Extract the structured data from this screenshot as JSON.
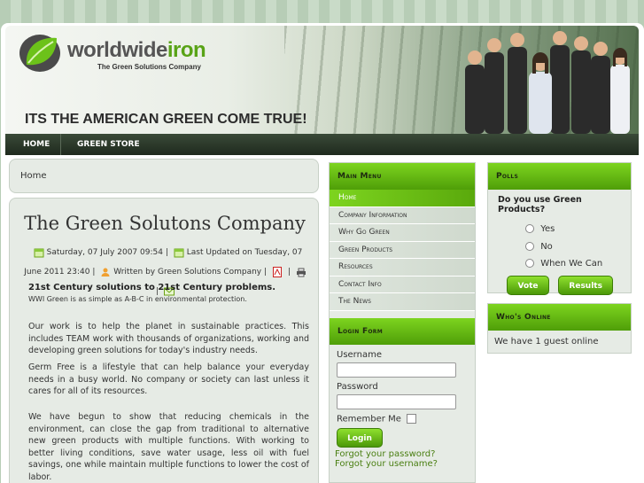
{
  "header": {
    "logo_main": "worldwide",
    "logo_accent": "iron",
    "tagline": "The Green Solutions Company",
    "slogan": "ITS THE AMERICAN GREEN COME TRUE!"
  },
  "nav": {
    "items": [
      {
        "label": "HOME"
      },
      {
        "label": "GREEN STORE"
      }
    ]
  },
  "breadcrumb": "Home",
  "article": {
    "title": "The Green Solutons Company",
    "meta_created": "Saturday, 07 July 2007 09:54",
    "meta_updated": "Last Updated on Tuesday, 07 June 2011 23:40",
    "meta_author": "Written by Green Solutions Company",
    "separator": "|",
    "lead_heading": "21st Century solutions to 21st Century problems.",
    "lead_sub": "WWI Green is as simple as A-B-C in environmental protection.",
    "paragraphs": [
      "Our work is to help the planet in sustainable practices. This includes TEAM work with thousands of organizations, working and developing green solutions for today's industry needs.",
      "Germ Free is a lifestyle that can help balance your everyday needs in a busy world. No company or society can last unless it cares for all of its resources.",
      "We have begun to show that reducing chemicals in the environment, can close the gap from traditional to alternative new green products with multiple functions. With working to better living conditions, save water usage, less oil with fuel savings, one  while maintain multiple functions to lower the cost of labor."
    ]
  },
  "main_menu": {
    "title": "Main Menu",
    "items": [
      {
        "label": "Home",
        "active": true
      },
      {
        "label": "Company Information",
        "active": false
      },
      {
        "label": "Why Go Green",
        "active": false
      },
      {
        "label": "Green Products",
        "active": false
      },
      {
        "label": "Resources",
        "active": false
      },
      {
        "label": "Contact Info",
        "active": false
      },
      {
        "label": "The News",
        "active": false
      }
    ]
  },
  "login": {
    "title": "Login Form",
    "username_label": "Username",
    "password_label": "Password",
    "remember_label": "Remember Me",
    "button": "Login",
    "forgot_password": "Forgot your password?",
    "forgot_username": "Forgot your username?"
  },
  "polls": {
    "title": "Polls",
    "question": "Do you use Green Products?",
    "options": [
      "Yes",
      "No",
      "When We Can"
    ],
    "vote_button": "Vote",
    "results_button": "Results"
  },
  "whos_online": {
    "title": "Who's Online",
    "text": "We have 1 guest online"
  },
  "colors": {
    "accent_green": "#5aa90c",
    "nav_dark": "#1f2a1e",
    "panel_bg": "#e6ebe5"
  }
}
